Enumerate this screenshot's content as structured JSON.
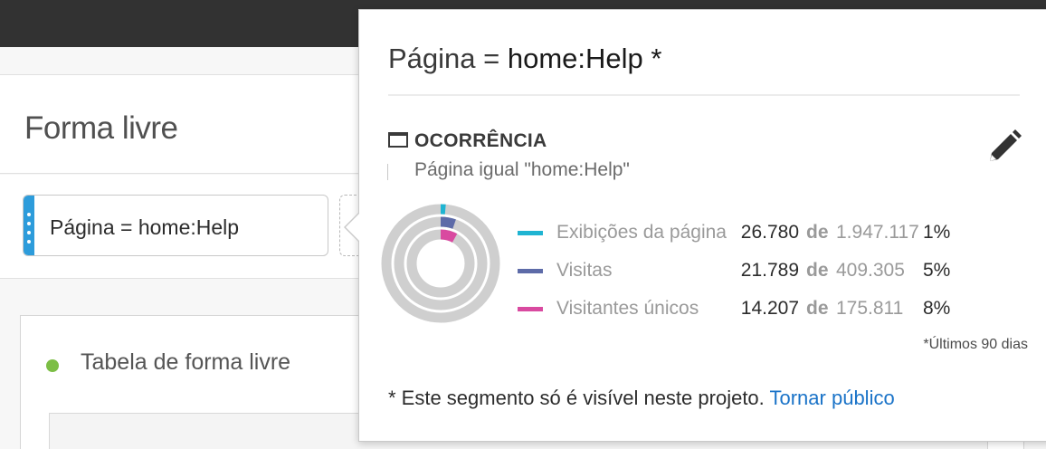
{
  "panel": {
    "title": "Forma livre"
  },
  "segment_chip": {
    "label": "Página = home:Help"
  },
  "table_panel": {
    "title": "Tabela de forma livre",
    "status_color": "#7cbe45"
  },
  "popover": {
    "title_prefix": "Página = ",
    "title_value": "home:Help *",
    "container_type": "OCORRÊNCIA",
    "container_icon": "window-icon",
    "rule": "Página igual \"home:Help\"",
    "edit_icon": "pencil-icon",
    "metrics": [
      {
        "name": "Exibições da página",
        "value": "26.780",
        "of": "de",
        "total": "1.947.117",
        "percent": "1%",
        "percent_value": 1.38,
        "color": "#1fb4d2"
      },
      {
        "name": "Visitas",
        "value": "21.789",
        "of": "de",
        "total": "409.305",
        "percent": "5%",
        "percent_value": 5.32,
        "color": "#5d6ba8"
      },
      {
        "name": "Visitantes únicos",
        "value": "14.207",
        "of": "de",
        "total": "175.811",
        "percent": "8%",
        "percent_value": 8.08,
        "color": "#d94aa0"
      }
    ],
    "footnote": "*Últimos 90 dias",
    "visibility_text": "* Este segmento só é visível neste projeto.",
    "make_public_link": "Tornar público"
  }
}
